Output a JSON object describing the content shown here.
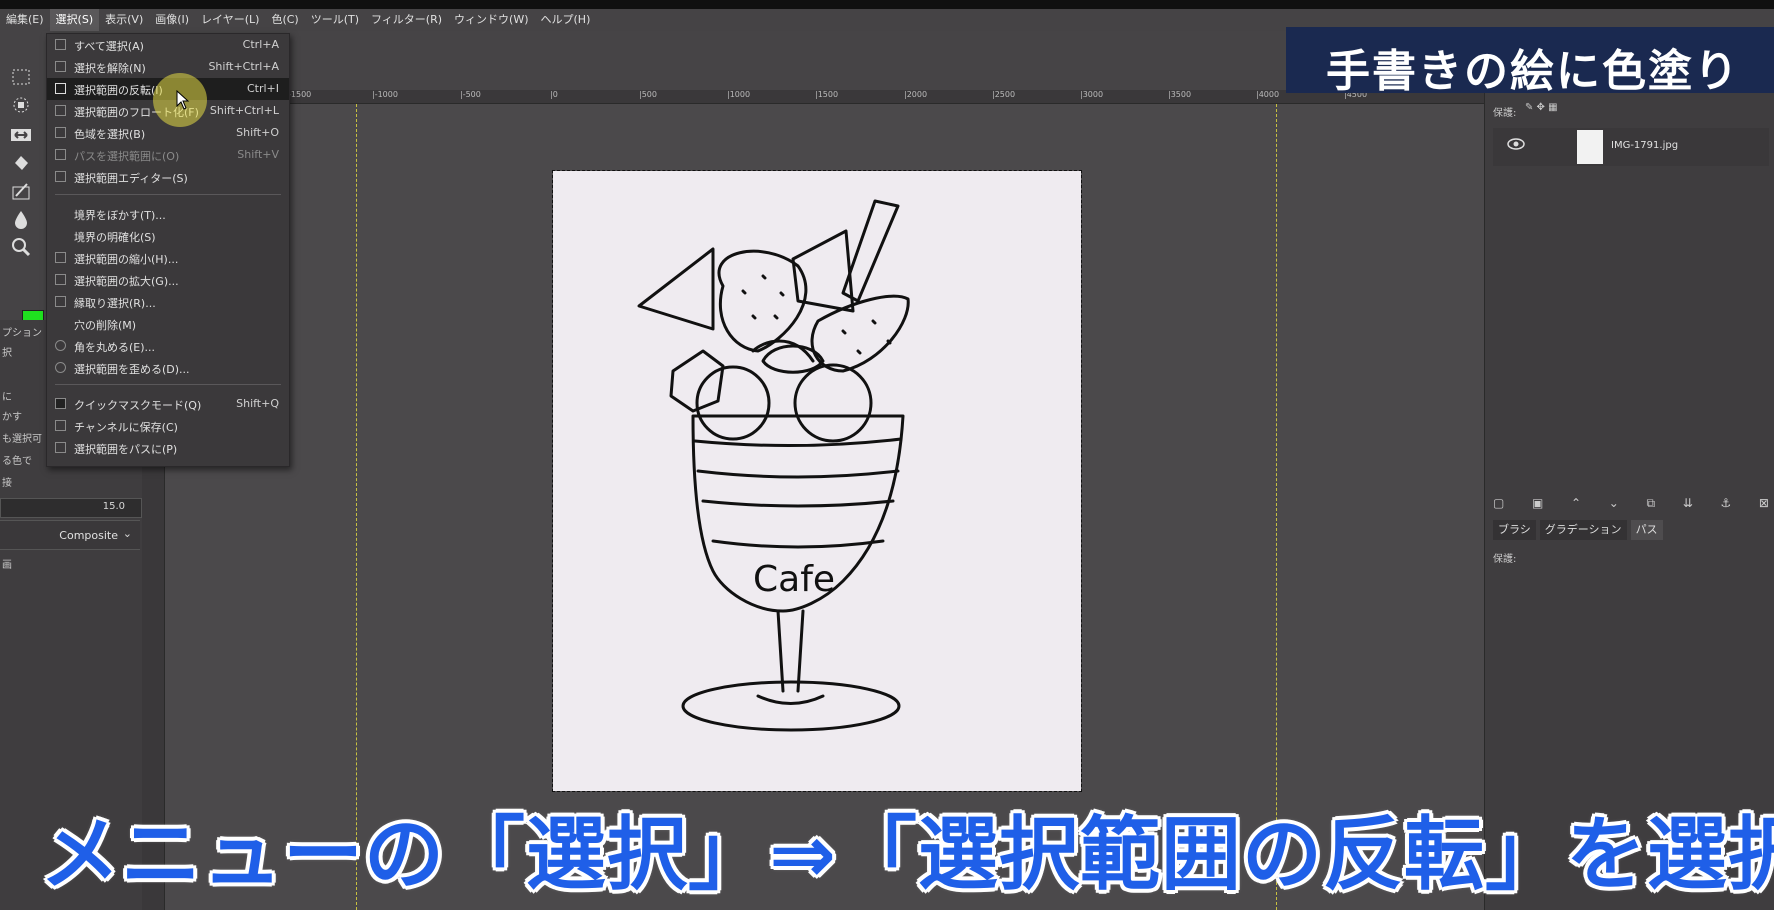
{
  "menubar": {
    "items": [
      "編集(E)",
      "選択(S)",
      "表示(V)",
      "画像(I)",
      "レイヤー(L)",
      "色(C)",
      "ツール(T)",
      "フィルター(R)",
      "ウィンドウ(W)",
      "ヘルプ(H)"
    ]
  },
  "select_menu": {
    "items": [
      {
        "label": "すべて選択(A)",
        "shortcut": "Ctrl+A"
      },
      {
        "label": "選択を解除(N)",
        "shortcut": "Shift+Ctrl+A"
      },
      {
        "label": "選択範囲の反転(I)",
        "shortcut": "Ctrl+I"
      },
      {
        "label": "選択範囲のフロート化(F)",
        "shortcut": "Shift+Ctrl+L"
      },
      {
        "label": "色域を選択(B)",
        "shortcut": "Shift+O"
      },
      {
        "label": "パスを選択範囲に(O)",
        "shortcut": "Shift+V"
      },
      {
        "label": "選択範囲エディター(S)",
        "shortcut": ""
      },
      {
        "label": "境界をぼかす(T)...",
        "shortcut": ""
      },
      {
        "label": "境界の明確化(S)",
        "shortcut": ""
      },
      {
        "label": "選択範囲の縮小(H)...",
        "shortcut": ""
      },
      {
        "label": "選択範囲の拡大(G)...",
        "shortcut": ""
      },
      {
        "label": "縁取り選択(R)...",
        "shortcut": ""
      },
      {
        "label": "穴の削除(M)",
        "shortcut": ""
      },
      {
        "label": "角を丸める(E)...",
        "shortcut": ""
      },
      {
        "label": "選択範囲を歪める(D)...",
        "shortcut": ""
      },
      {
        "label": "クイックマスクモード(Q)",
        "shortcut": "Shift+Q"
      },
      {
        "label": "チャンネルに保存(C)",
        "shortcut": ""
      },
      {
        "label": "選択範囲をパスに(P)",
        "shortcut": ""
      }
    ]
  },
  "ruler": {
    "h_ticks": [
      "-1500",
      "|-1000",
      "|-500",
      "|0",
      "|500",
      "|1000",
      "|1500",
      "|2000",
      "|2500",
      "|3000",
      "|3500",
      "|4000",
      "|4500"
    ]
  },
  "tool_options": {
    "rows": [
      "プション",
      "択",
      "に",
      "かす",
      "も選択可",
      "る色で",
      "接"
    ],
    "spin_value": "15.0",
    "mode": "Composite",
    "footer": "画"
  },
  "layers": {
    "lock_label": "保護:",
    "layer_name": "IMG-1791.jpg",
    "tabs": [
      "ブラシ",
      "グラデーション",
      "パス"
    ],
    "lock_label2": "保護:"
  },
  "canvas": {
    "cafe_text": "Cafe"
  },
  "banner": {
    "title": "手書きの絵に色塗り"
  },
  "caption": {
    "text": "メニューの「選択」⇒「選択範囲の反転」を選択"
  },
  "colors": {
    "foreground": "#1fe11f",
    "caption_blue": "#1f5fe8",
    "banner_bg": "#1a2950"
  }
}
